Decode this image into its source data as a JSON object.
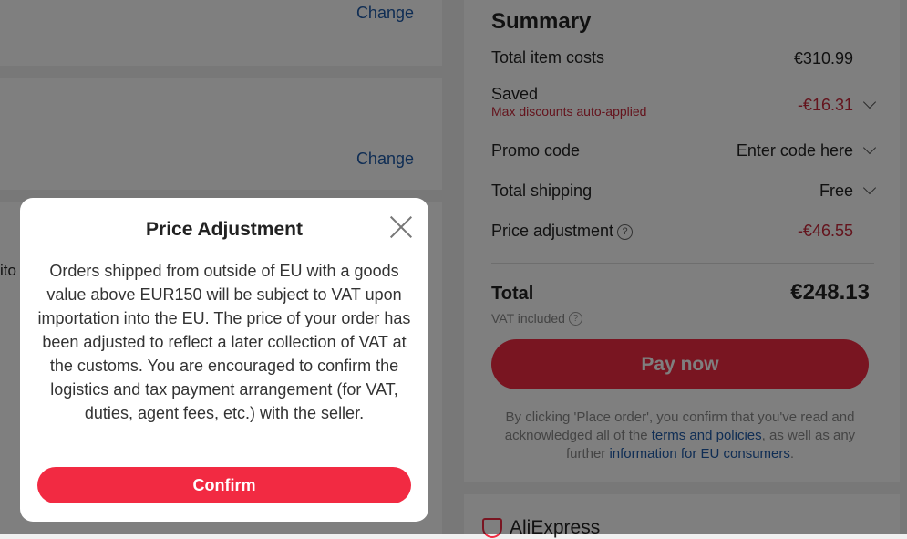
{
  "background": {
    "change_label_1": "Change",
    "change_label_2": "Change",
    "cut_text": "ito"
  },
  "summary": {
    "title": "Summary",
    "total_item_costs_label": "Total item costs",
    "total_item_costs_value": "€310.99",
    "saved_label": "Saved",
    "saved_note": "Max discounts auto-applied",
    "saved_value": "-€16.31",
    "promo_label": "Promo code",
    "promo_value": "Enter code here",
    "shipping_label": "Total shipping",
    "shipping_value": "Free",
    "price_adjustment_label": "Price adjustment",
    "price_adjustment_value": "-€46.55",
    "total_label": "Total",
    "total_value": "€248.13",
    "vat_label": "VAT included",
    "pay_button": "Pay now",
    "legal_prefix": "By clicking 'Place order', you confirm that you've read and acknowledged all of the ",
    "legal_link_terms": "terms and policies",
    "legal_middle": ", as well as any further ",
    "legal_link_eu": "information for EU consumers",
    "legal_suffix": "."
  },
  "brand": {
    "name": "AliExpress"
  },
  "modal": {
    "title": "Price Adjustment",
    "body": "Orders shipped from outside of EU with a goods value above EUR150 will be subject to VAT upon importation into the EU. The price of your order has been adjusted to reflect a later collection of VAT at the customs. You are encouraged to confirm the logistics and tax payment arrangement (for VAT, duties, agent fees, etc.) with the seller.",
    "confirm_button": "Confirm"
  },
  "colors": {
    "accent": "#f22a42",
    "discount_red": "#c8283a",
    "link_blue": "#1e5aa8"
  }
}
